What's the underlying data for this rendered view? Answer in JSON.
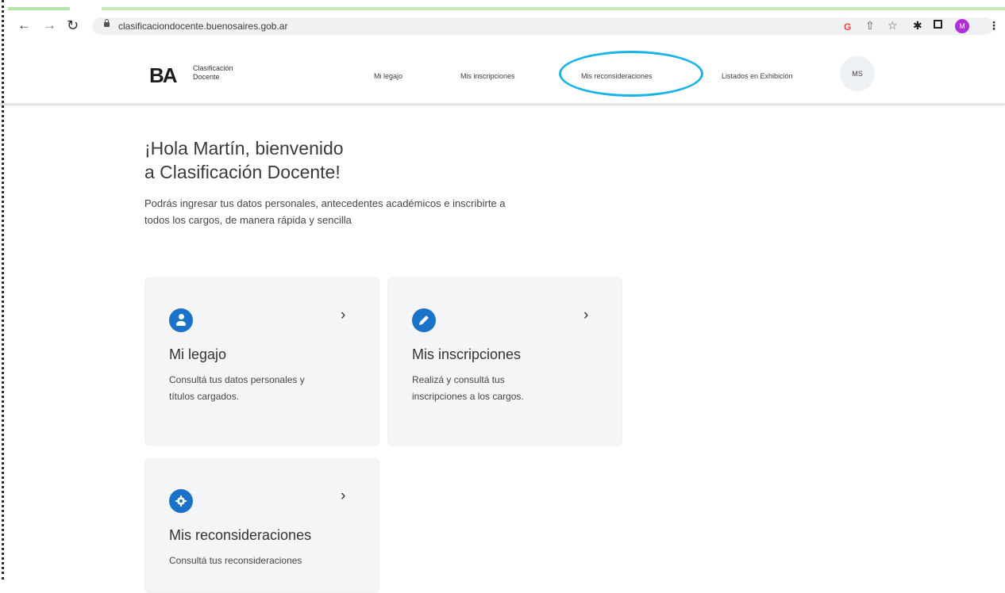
{
  "browser": {
    "url": "clasificaciondocente.buenosaires.gob.ar",
    "profile_initial": "M"
  },
  "header": {
    "logo_mark": "BA",
    "logo_line1": "Clasificación",
    "logo_line2": "Docente",
    "nav": {
      "legajo": "Mi legajo",
      "inscripciones": "Mis inscripciones",
      "reconsideraciones": "Mis reconsideraciones",
      "listados": "Listados en Exhibición"
    },
    "user_initials": "MS",
    "highlight_color": "#19b4e6"
  },
  "main": {
    "welcome_line1": "¡Hola Martín, bienvenido",
    "welcome_line2": "a Clasificación Docente!",
    "description": "Podrás ingresar tus datos personales, antecedentes académicos e inscribirte a todos los cargos, de manera rápida y sencilla",
    "cards": [
      {
        "icon": "person-icon",
        "title": "Mi legajo",
        "text": "Consultá tus datos personales y títulos cargados."
      },
      {
        "icon": "pencil-icon",
        "title": "Mis inscripciones",
        "text": "Realizá y consultá tus inscripciones a los cargos."
      },
      {
        "icon": "gear-icon",
        "title": "Mis reconsideraciones",
        "text": "Consultá tus reconsideraciones"
      }
    ],
    "accent_color": "#1a73c8"
  }
}
